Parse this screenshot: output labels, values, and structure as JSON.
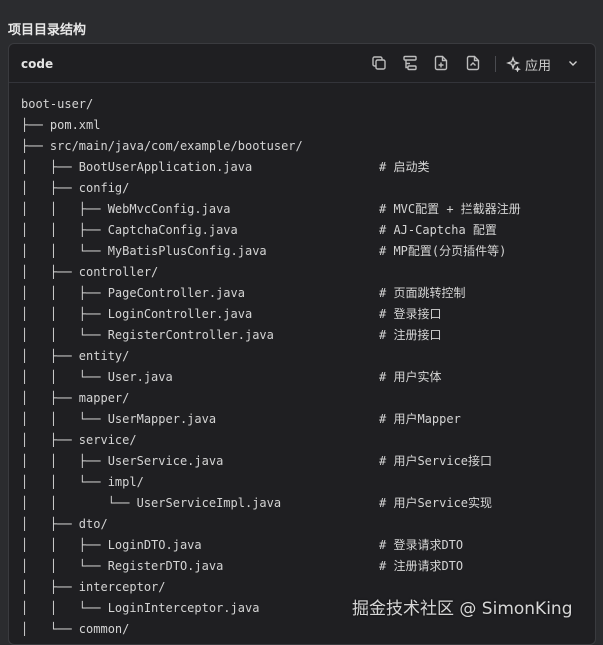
{
  "section_title": "项目目录结构",
  "code_block": {
    "language": "code",
    "apply_label": "应用",
    "icons": [
      "copy-icon",
      "branch-icon",
      "insert-file-icon",
      "export-file-icon",
      "sparkle-icon",
      "chevron-down-icon"
    ],
    "lines": [
      {
        "tree": "boot-user/",
        "comment": ""
      },
      {
        "tree": "├── pom.xml",
        "comment": ""
      },
      {
        "tree": "├── src/main/java/com/example/bootuser/",
        "comment": ""
      },
      {
        "tree": "│   ├── BootUserApplication.java",
        "comment": "# 启动类"
      },
      {
        "tree": "│   ├── config/",
        "comment": ""
      },
      {
        "tree": "│   │   ├── WebMvcConfig.java",
        "comment": "# MVC配置 + 拦截器注册"
      },
      {
        "tree": "│   │   ├── CaptchaConfig.java",
        "comment": "# AJ-Captcha 配置"
      },
      {
        "tree": "│   │   └── MyBatisPlusConfig.java",
        "comment": "# MP配置(分页插件等)"
      },
      {
        "tree": "│   ├── controller/",
        "comment": ""
      },
      {
        "tree": "│   │   ├── PageController.java",
        "comment": "# 页面跳转控制"
      },
      {
        "tree": "│   │   ├── LoginController.java",
        "comment": "# 登录接口"
      },
      {
        "tree": "│   │   └── RegisterController.java",
        "comment": "# 注册接口"
      },
      {
        "tree": "│   ├── entity/",
        "comment": ""
      },
      {
        "tree": "│   │   └── User.java",
        "comment": "# 用户实体"
      },
      {
        "tree": "│   ├── mapper/",
        "comment": ""
      },
      {
        "tree": "│   │   └── UserMapper.java",
        "comment": "# 用户Mapper"
      },
      {
        "tree": "│   ├── service/",
        "comment": ""
      },
      {
        "tree": "│   │   ├── UserService.java",
        "comment": "# 用户Service接口"
      },
      {
        "tree": "│   │   └── impl/",
        "comment": ""
      },
      {
        "tree": "│   │       └── UserServiceImpl.java",
        "comment": "# 用户Service实现"
      },
      {
        "tree": "│   ├── dto/",
        "comment": ""
      },
      {
        "tree": "│   │   ├── LoginDTO.java",
        "comment": "# 登录请求DTO"
      },
      {
        "tree": "│   │   └── RegisterDTO.java",
        "comment": "# 注册请求DTO"
      },
      {
        "tree": "│   ├── interceptor/",
        "comment": ""
      },
      {
        "tree": "│   │   └── LoginInterceptor.java",
        "comment": ""
      },
      {
        "tree": "│   └── common/",
        "comment": ""
      }
    ]
  },
  "watermark": "掘金技术社区 @ SimonKing"
}
